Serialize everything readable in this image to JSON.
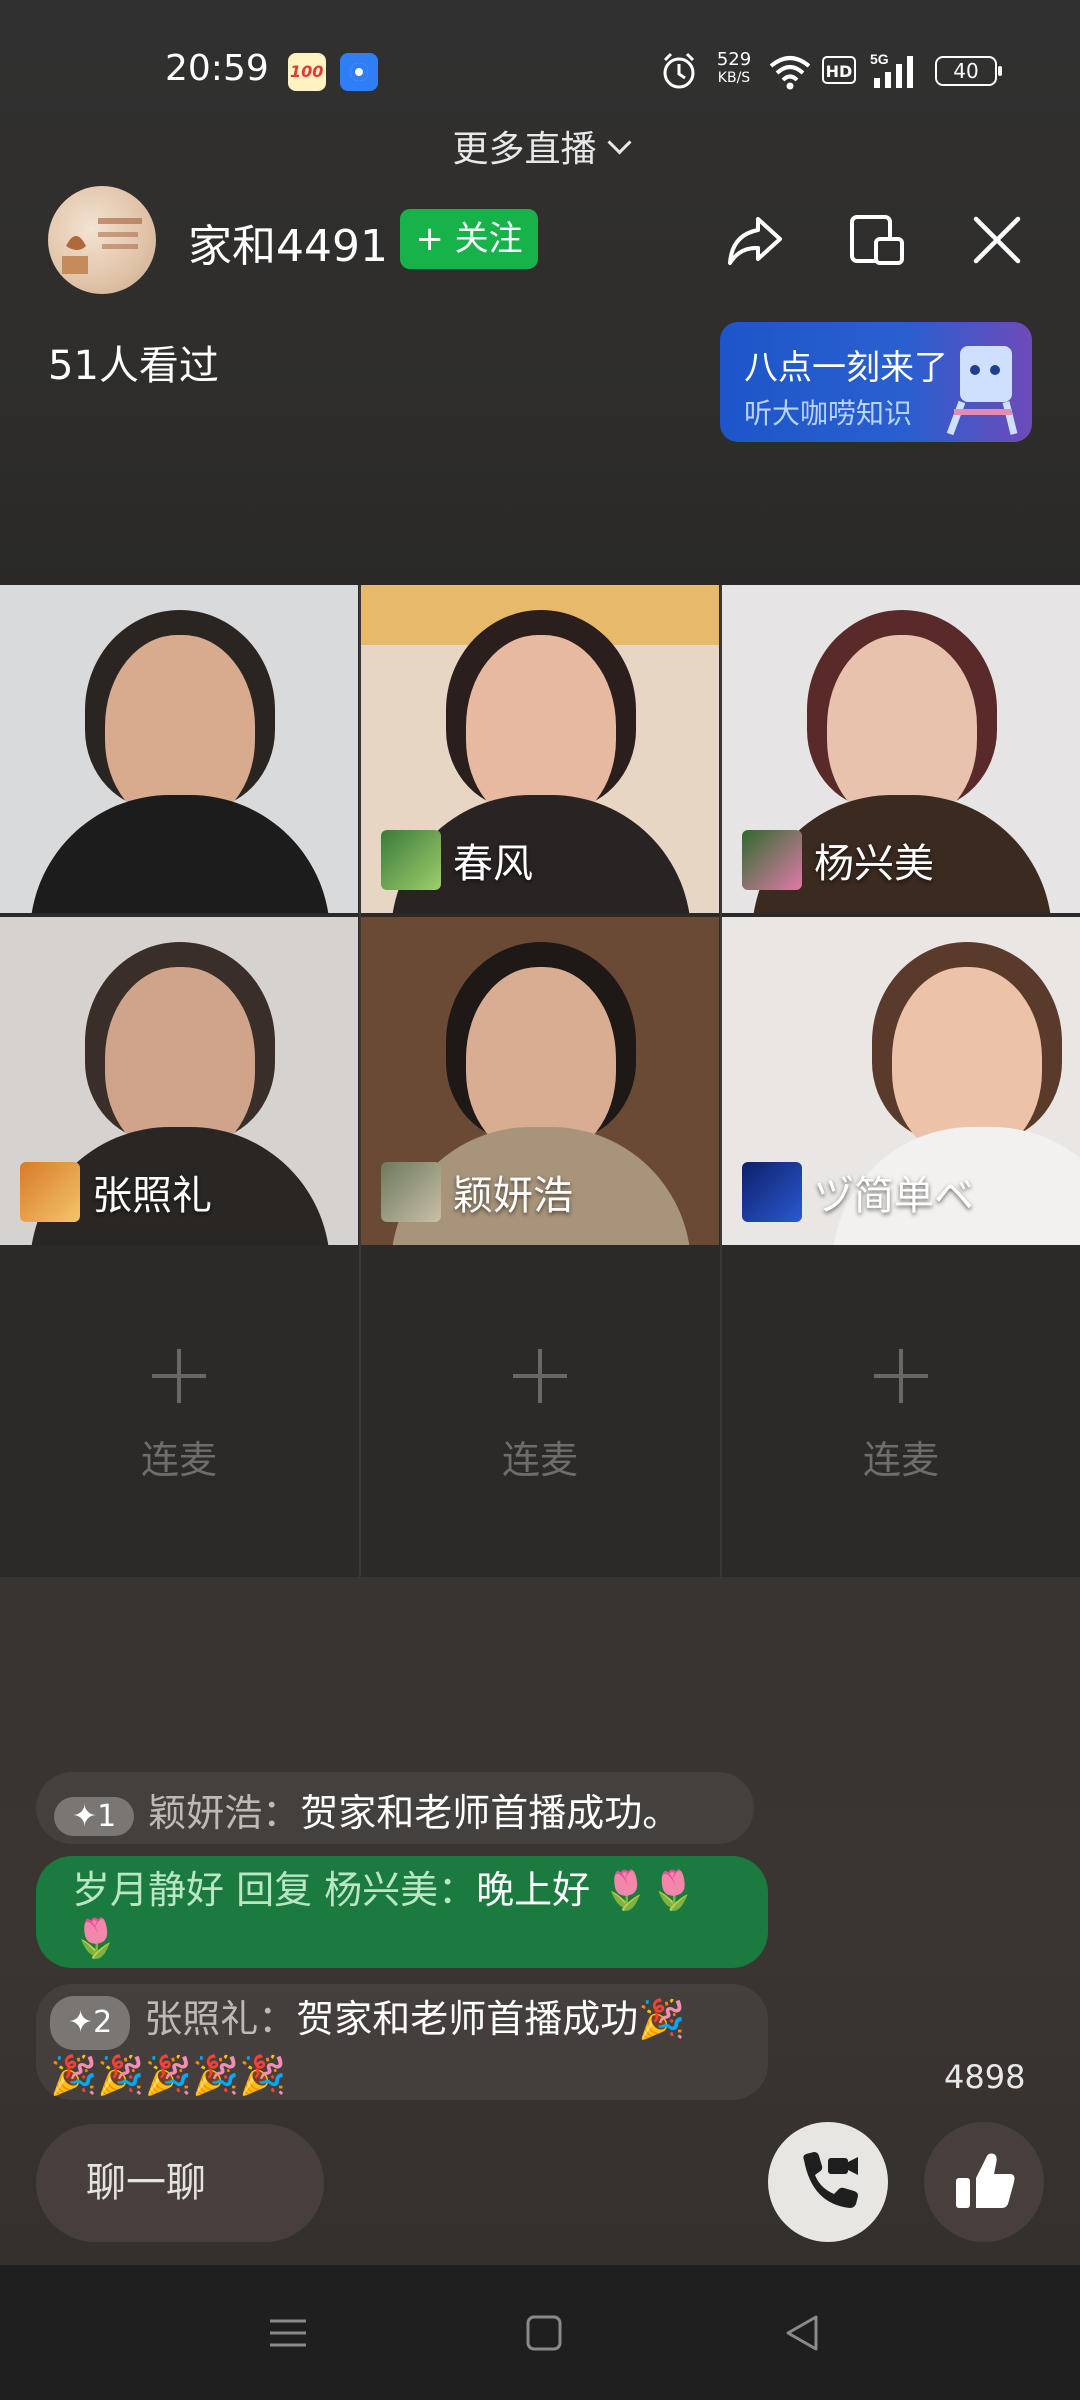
{
  "status_bar": {
    "time": "20:59",
    "net_speed_value": "529",
    "net_speed_unit": "KB/S",
    "hd": "HD",
    "signal": "5G",
    "battery": "40"
  },
  "more_live": "更多直播",
  "host": {
    "name": "家和4491",
    "follow_label": "+ 关注",
    "viewers": "51人看过"
  },
  "promo": {
    "line1": "八点一刻来了",
    "line2": "听大咖唠知识"
  },
  "participants": [
    {
      "name": ""
    },
    {
      "name": "春风"
    },
    {
      "name": "杨兴美"
    },
    {
      "name": "张照礼"
    },
    {
      "name": "颖妍浩"
    },
    {
      "name": "ヅ简单ベ"
    }
  ],
  "empty_slots": [
    {
      "label": "连麦"
    },
    {
      "label": "连麦"
    },
    {
      "label": "连麦"
    }
  ],
  "chat": [
    {
      "badge": "✦1",
      "user": "颖妍浩：",
      "text": "贺家和老师首播成功。"
    },
    {
      "user": "岁月静好 回复 杨兴美：",
      "text": "晚上好"
    },
    {
      "badge": "✦2",
      "user": "张照礼：",
      "text": "贺家和老师首播成功"
    }
  ],
  "like_count": "4898",
  "chat_input_placeholder": "聊一聊",
  "colors": {
    "follow_green": "#18b24b",
    "reply_bubble_green": "#1b7a3d",
    "promo_blue": "#1d56c9"
  }
}
